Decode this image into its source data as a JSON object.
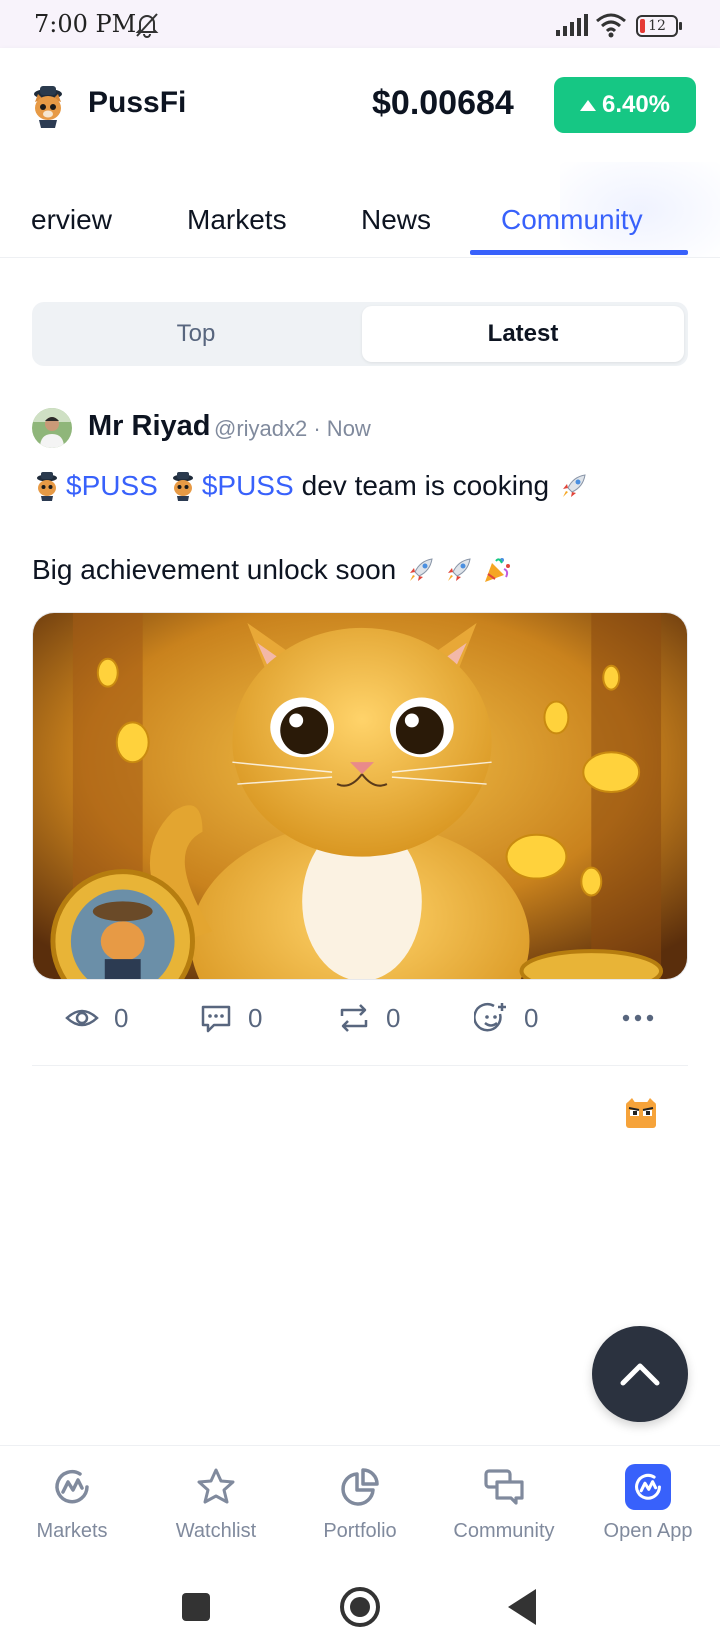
{
  "status_bar": {
    "time": "7:00 PM",
    "battery": "12"
  },
  "header": {
    "coin_name": "PussFi",
    "price": "$0.00684",
    "change": "6.40%"
  },
  "tabs": [
    {
      "label": "erview",
      "active": false
    },
    {
      "label": "Markets",
      "active": false
    },
    {
      "label": "News",
      "active": false
    },
    {
      "label": "Community",
      "active": true
    }
  ],
  "segment": {
    "top": "Top",
    "latest": "Latest",
    "selected": "Latest"
  },
  "post": {
    "author": "Mr Riyad",
    "handle": "@riyadx2 · Now",
    "tag1": "$PUSS",
    "tag2": "$PUSS",
    "line1_rest": "dev team is cooking",
    "line2": "Big achievement unlock soon",
    "views": "0",
    "comments": "0",
    "reposts": "0",
    "reactions": "0"
  },
  "bottom_nav": [
    {
      "label": "Markets",
      "icon": "markets-icon"
    },
    {
      "label": "Watchlist",
      "icon": "star-icon"
    },
    {
      "label": "Portfolio",
      "icon": "pie-chart-icon"
    },
    {
      "label": "Community",
      "icon": "chat-bubbles-icon"
    },
    {
      "label": "Open App",
      "icon": "open-app-icon"
    }
  ],
  "colors": {
    "accent": "#3861fb",
    "positive": "#16c784",
    "text": "#0d1421",
    "muted": "#808a9d"
  }
}
